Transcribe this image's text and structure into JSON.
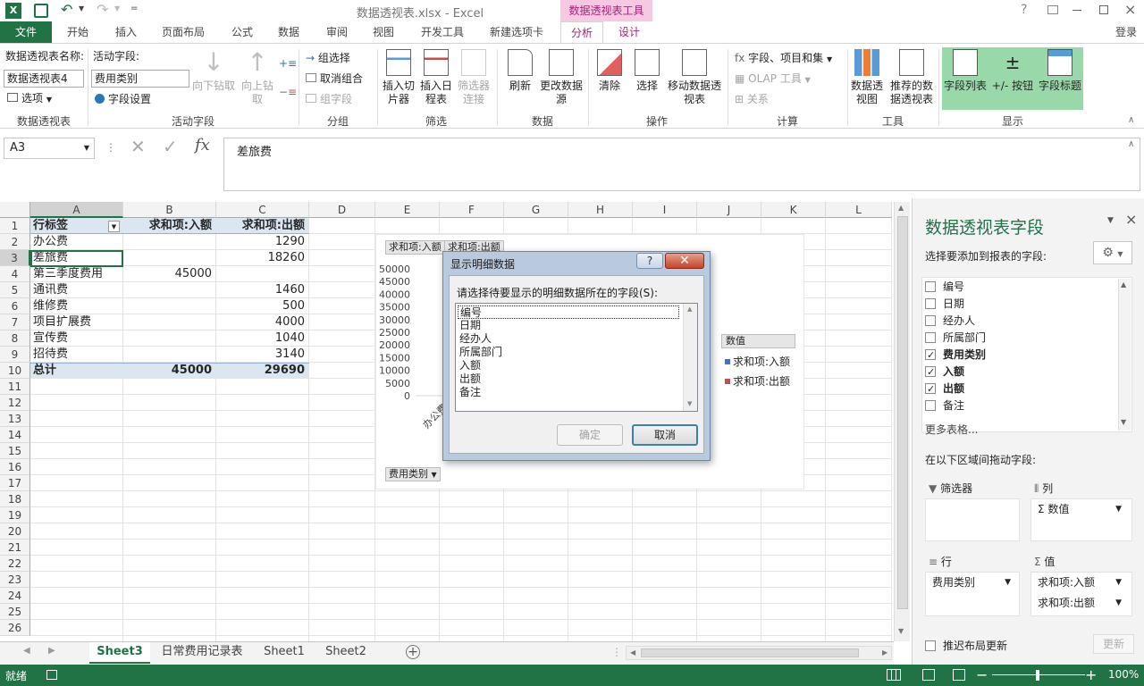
{
  "titlebar": {
    "title": "数据透视表.xlsx - Excel",
    "context_tab": "数据透视表工具",
    "help": "?"
  },
  "tabs": [
    "文件",
    "开始",
    "插入",
    "页面布局",
    "公式",
    "数据",
    "审阅",
    "视图",
    "开发工具",
    "新建选项卡",
    "分析",
    "设计"
  ],
  "login": "登录",
  "ribbon": {
    "pt_name_label": "数据透视表名称:",
    "pt_name_value": "数据透视表4",
    "options": "选项",
    "active_field_label": "活动字段:",
    "active_field_value": "费用类别",
    "field_settings": "字段设置",
    "drill_down": "向下钻取",
    "drill_up": "向上钻取",
    "group_selection": "组选择",
    "ungroup": "取消组合",
    "group_field": "组字段",
    "insert_slicer": "插入切片器",
    "insert_timeline": "插入日程表",
    "filter_conn": "筛选器连接",
    "refresh": "刷新",
    "change_source": "更改数据源",
    "clear": "清除",
    "select": "选择",
    "move_pt": "移动数据透视表",
    "fields_items": "字段、项目和集",
    "olap": "OLAP 工具",
    "relations": "关系",
    "pivot_chart": "数据透视图",
    "recommended": "推荐的数据透视表",
    "field_list": "字段列表",
    "buttons": "+/- 按钮",
    "field_headers": "字段标题",
    "groups": [
      "数据透视表",
      "活动字段",
      "分组",
      "筛选",
      "数据",
      "操作",
      "计算",
      "工具",
      "显示"
    ]
  },
  "formula_bar": {
    "name_box": "A3",
    "fx": "fx",
    "content": "差旅费"
  },
  "columns": [
    "A",
    "B",
    "C",
    "D",
    "E",
    "F",
    "G",
    "H",
    "I",
    "J",
    "K",
    "L"
  ],
  "rows": [
    "1",
    "2",
    "3",
    "4",
    "5",
    "6",
    "7",
    "8",
    "9",
    "10",
    "11",
    "12",
    "13",
    "14",
    "15",
    "16",
    "17",
    "18",
    "19",
    "20",
    "21",
    "22",
    "23",
    "24",
    "25",
    "26"
  ],
  "table": {
    "header": [
      "行标签",
      "求和项:入额",
      "求和项:出额"
    ],
    "data": [
      [
        "办公费",
        "",
        "1290"
      ],
      [
        "差旅费",
        "",
        "18260"
      ],
      [
        "第三季度费用",
        "45000",
        ""
      ],
      [
        "通讯费",
        "",
        "1460"
      ],
      [
        "维修费",
        "",
        "500"
      ],
      [
        "项目扩展费",
        "",
        "4000"
      ],
      [
        "宣传费",
        "",
        "1040"
      ],
      [
        "招待费",
        "",
        "3140"
      ]
    ],
    "total": [
      "总计",
      "45000",
      "29690"
    ]
  },
  "chart_data": {
    "type": "bar",
    "field_buttons": [
      "求和项:入额",
      "求和项:出额"
    ],
    "y_ticks": [
      "50000",
      "45000",
      "40000",
      "35000",
      "30000",
      "25000",
      "20000",
      "15000",
      "10000",
      "5000",
      "0"
    ],
    "ylim": [
      0,
      50000
    ],
    "categories": [
      "办公费"
    ],
    "series": [
      {
        "name": "求和项:入额",
        "values": [
          0
        ],
        "color": "#4472c4"
      },
      {
        "name": "求和项:出额",
        "values": [
          1290
        ],
        "color": "#c0504d"
      }
    ],
    "legend_title": "数值",
    "axis_button": "费用类别"
  },
  "dialog": {
    "title": "显示明细数据",
    "prompt": "请选择待要显示的明细数据所在的字段(S):",
    "items": [
      "编号",
      "日期",
      "经办人",
      "所属部门",
      "入额",
      "出额",
      "备注"
    ],
    "ok": "确定",
    "cancel": "取消"
  },
  "sheet_tabs": [
    "Sheet3",
    "日常费用记录表",
    "Sheet1",
    "Sheet2"
  ],
  "status": {
    "ready": "就绪",
    "zoom": "100%"
  },
  "pane": {
    "title": "数据透视表字段",
    "subtitle": "选择要添加到报表的字段:",
    "fields": [
      {
        "name": "编号",
        "checked": false
      },
      {
        "name": "日期",
        "checked": false
      },
      {
        "name": "经办人",
        "checked": false
      },
      {
        "name": "所属部门",
        "checked": false
      },
      {
        "name": "费用类别",
        "checked": true
      },
      {
        "name": "入额",
        "checked": true
      },
      {
        "name": "出额",
        "checked": true
      },
      {
        "name": "备注",
        "checked": false
      }
    ],
    "more_tables": "更多表格...",
    "drag_hint": "在以下区域间拖动字段:",
    "filters": "筛选器",
    "columns": "列",
    "columns_item": "数值",
    "rows": "行",
    "rows_item": "费用类别",
    "values": "值",
    "values_items": [
      "求和项:入额",
      "求和项:出额"
    ],
    "defer": "推迟布局更新",
    "update": "更新"
  },
  "colors": {
    "excel_green": "#217346",
    "pane_highlight": "#99d9a9",
    "context_pink": "#f7c8e2"
  }
}
